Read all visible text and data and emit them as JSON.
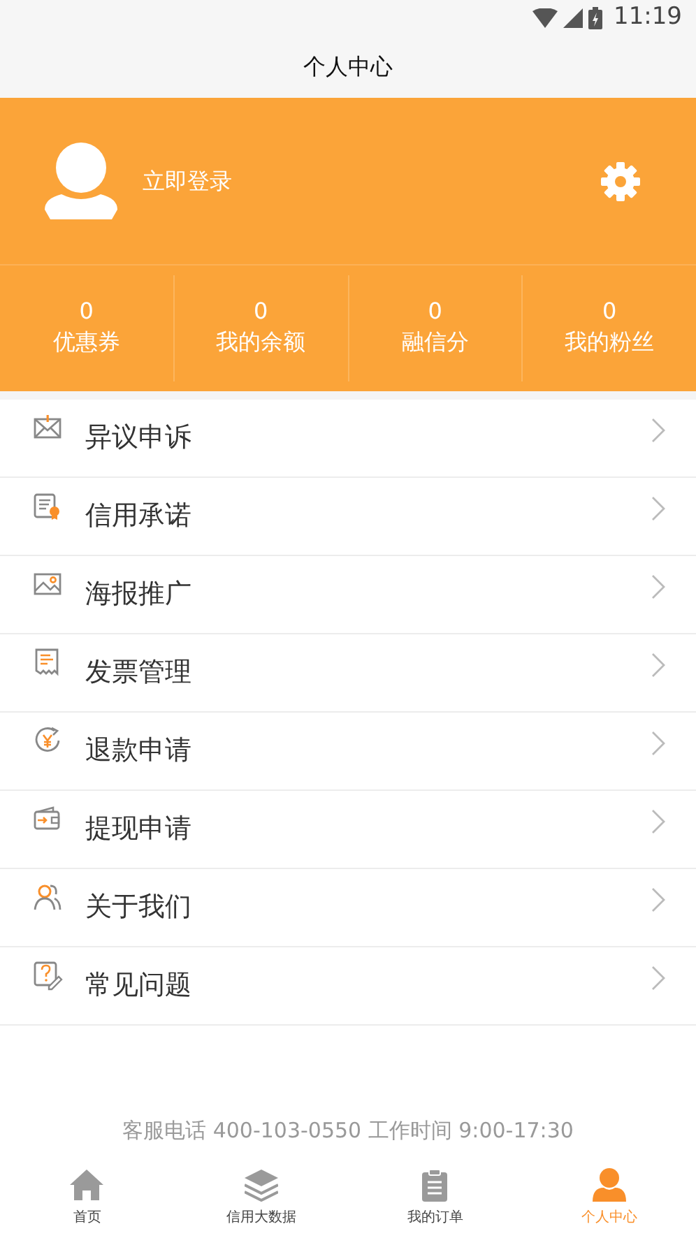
{
  "status_bar": {
    "time": "11:19"
  },
  "title": "个人中心",
  "profile": {
    "login_label": "立即登录"
  },
  "stats": [
    {
      "value": "0",
      "label": "优惠券"
    },
    {
      "value": "0",
      "label": "我的余额"
    },
    {
      "value": "0",
      "label": "融信分"
    },
    {
      "value": "0",
      "label": "我的粉丝"
    }
  ],
  "menu": [
    {
      "kind": "envelope",
      "label": "异议申诉"
    },
    {
      "kind": "certificate",
      "label": "信用承诺"
    },
    {
      "kind": "image",
      "label": "海报推广"
    },
    {
      "kind": "receipt",
      "label": "发票管理"
    },
    {
      "kind": "refund",
      "label": "退款申请"
    },
    {
      "kind": "wallet",
      "label": "提现申请"
    },
    {
      "kind": "people",
      "label": "关于我们"
    },
    {
      "kind": "question",
      "label": "常见问题"
    }
  ],
  "service_info": "客服电话  400-103-0550  工作时间 9:00-17:30",
  "tab_bar": [
    {
      "kind": "home",
      "label": "首页",
      "selected": false
    },
    {
      "kind": "layers",
      "label": "信用大数据",
      "selected": false
    },
    {
      "kind": "clipboard",
      "label": "我的订单",
      "selected": false
    },
    {
      "kind": "person",
      "label": "个人中心",
      "selected": true
    }
  ]
}
